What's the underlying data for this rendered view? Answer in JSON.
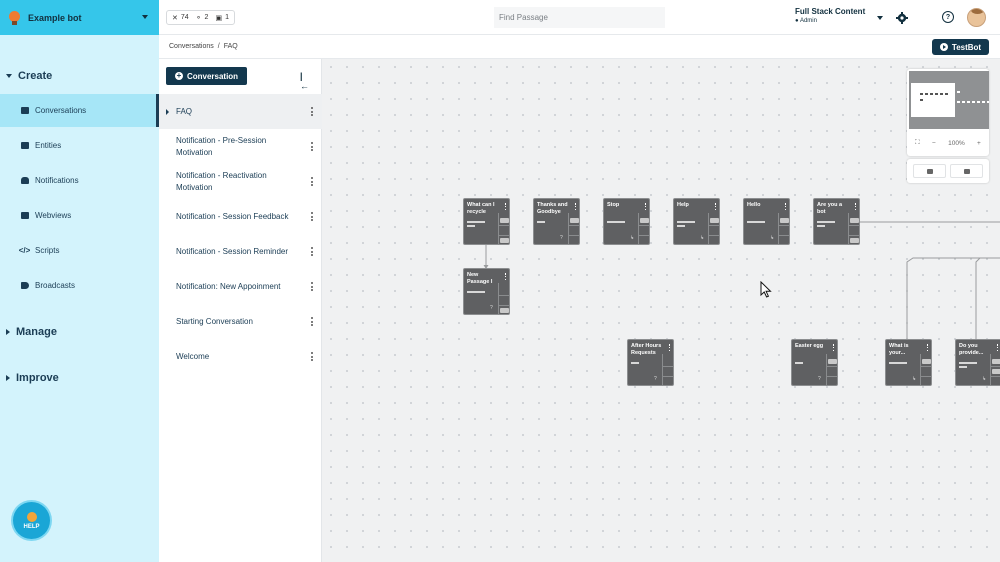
{
  "bot": {
    "name": "Example bot"
  },
  "stats": {
    "passages": "74",
    "folders": "2",
    "locked": "1"
  },
  "search": {
    "placeholder": "Find Passage"
  },
  "account": {
    "org": "Full Stack Content",
    "role": "Admin"
  },
  "breadcrumb": {
    "root": "Conversations",
    "separator": "/",
    "current": "FAQ"
  },
  "actions": {
    "testbot": "TestBot",
    "new_conversation": "Conversation"
  },
  "help": {
    "label": "HELP"
  },
  "sections": {
    "create": "Create",
    "manage": "Manage",
    "improve": "Improve"
  },
  "nav": [
    {
      "label": "Conversations",
      "icon": "chat-bubble-icon"
    },
    {
      "label": "Entities",
      "icon": "entity-icon"
    },
    {
      "label": "Notifications",
      "icon": "bell-icon"
    },
    {
      "label": "Webviews",
      "icon": "browser-icon"
    },
    {
      "label": "Scripts",
      "icon": "code-icon"
    },
    {
      "label": "Broadcasts",
      "icon": "megaphone-icon"
    }
  ],
  "conversations": [
    "FAQ",
    "Notification - Pre-Session Motivation",
    "Notification - Reactivation Motivation",
    "Notification - Session Feedback",
    "Notification - Session Reminder",
    "Notification: New Appoinment",
    "Starting Conversation",
    "Welcome"
  ],
  "passages": [
    {
      "title": "What can I recycle"
    },
    {
      "title": "Thanks and Goodbye"
    },
    {
      "title": "Stop"
    },
    {
      "title": "Help"
    },
    {
      "title": "Hello"
    },
    {
      "title": "Are you a bot"
    },
    {
      "title": "New Passage I"
    },
    {
      "title": "After Hours Requests"
    },
    {
      "title": "Easter egg"
    },
    {
      "title": "What is your..."
    },
    {
      "title": "Do you provide..."
    }
  ],
  "minimap": {
    "zoom": "100%",
    "zoom_out": "−",
    "zoom_in": "+"
  }
}
